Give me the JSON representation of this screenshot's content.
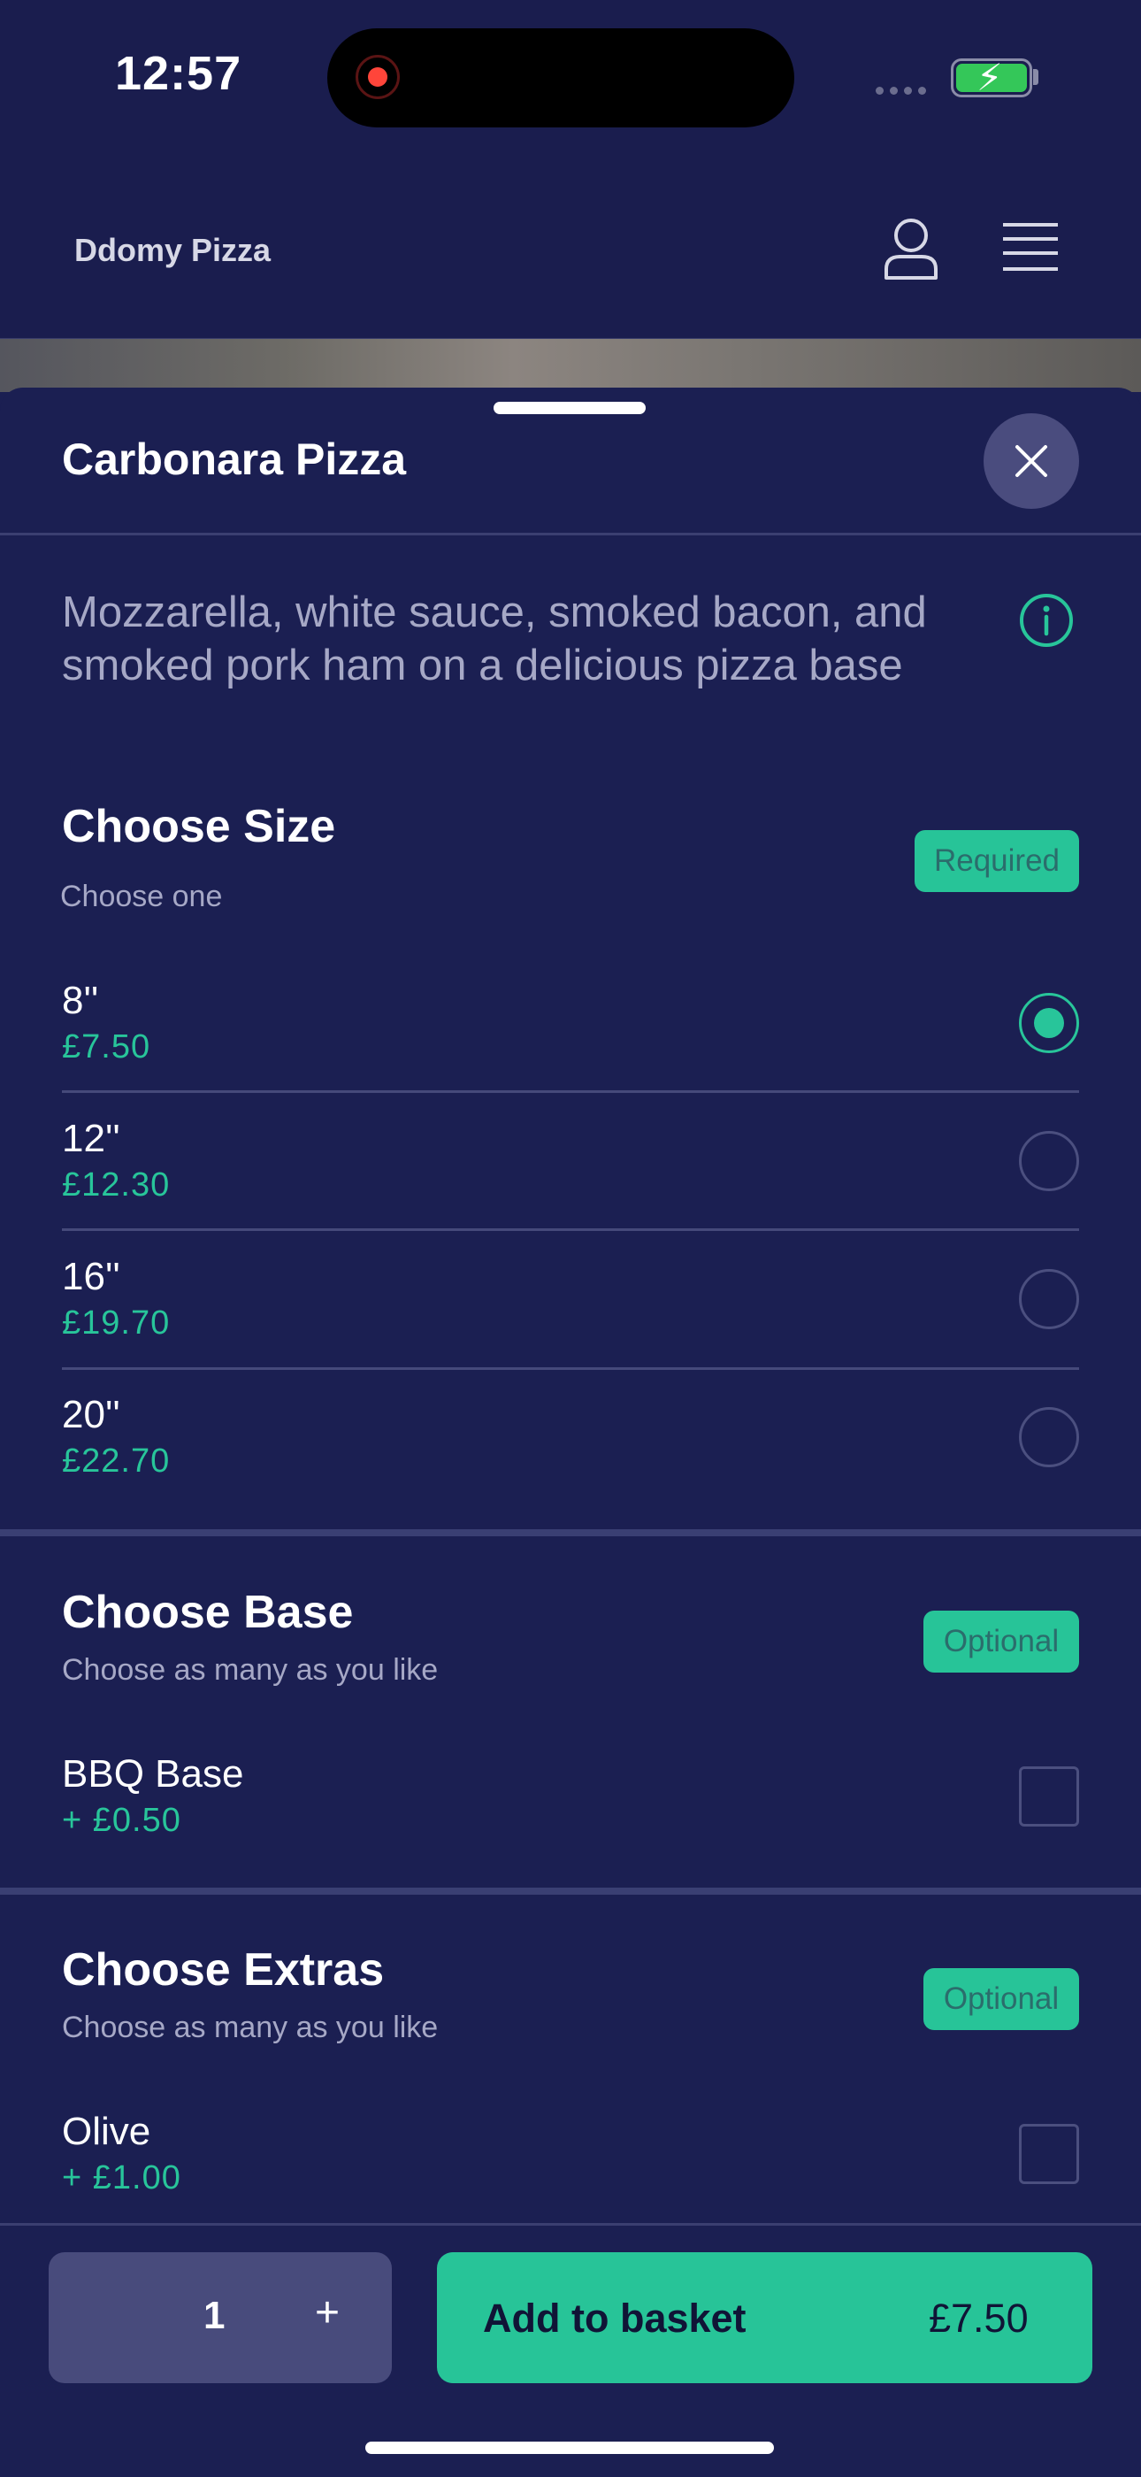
{
  "status_bar": {
    "time": "12:57"
  },
  "header": {
    "brand": "Ddomy Pizza",
    "icons": [
      "user-icon",
      "menu-icon"
    ]
  },
  "item": {
    "title": "Carbonara Pizza",
    "description": "Mozzarella, white sauce, smoked bacon, and smoked pork ham on a delicious pizza base"
  },
  "sections": {
    "size": {
      "title": "Choose Size",
      "subtitle": "Choose one",
      "badge": "Required",
      "options": [
        {
          "name": "8''",
          "price": "£7.50",
          "selected": true
        },
        {
          "name": "12''",
          "price": "£12.30",
          "selected": false
        },
        {
          "name": "16''",
          "price": "£19.70",
          "selected": false
        },
        {
          "name": "20''",
          "price": "£22.70",
          "selected": false
        }
      ]
    },
    "base": {
      "title": "Choose Base",
      "subtitle": "Choose as many as you like",
      "badge": "Optional",
      "options": [
        {
          "name": "BBQ Base",
          "price": "+ £0.50",
          "checked": false
        }
      ]
    },
    "extras": {
      "title": "Choose Extras",
      "subtitle": "Choose as many as you like",
      "badge": "Optional",
      "options": [
        {
          "name": "Olive",
          "price": "+ £1.00",
          "checked": false
        }
      ]
    }
  },
  "bottom_bar": {
    "quantity": "1",
    "plus": "+",
    "add_label": "Add to basket",
    "add_price": "£7.50"
  },
  "colors": {
    "background": "#1b1f52",
    "accent": "#27c498",
    "muted_text": "#a6a8c6"
  }
}
